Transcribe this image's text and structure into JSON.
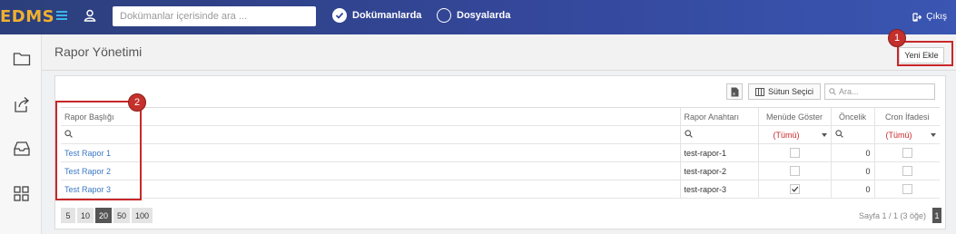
{
  "app": {
    "brand": "EDMS"
  },
  "topbar": {
    "search_placeholder": "Dokümanlar içerisinde ara ...",
    "scope_documents": "Dokümanlarda",
    "scope_files": "Dosyalarda",
    "logout_label": "Çıkış"
  },
  "sidebar": {
    "icons": [
      "folder-icon",
      "share-icon",
      "inbox-icon",
      "apps-grid-icon"
    ]
  },
  "page": {
    "title": "Rapor Yönetimi",
    "new_button": "Yeni Ekle"
  },
  "annotations": {
    "badge_1": "1",
    "badge_2": "2"
  },
  "toolbar": {
    "column_chooser": "Sütun Seçici",
    "search_placeholder": "Ara..."
  },
  "grid": {
    "columns": {
      "title": "Rapor Başlığı",
      "key": "Rapor Anahtarı",
      "show_menu": "Menüde Göster",
      "priority": "Öncelik",
      "cron": "Cron İfadesi"
    },
    "filter_all": "(Tümü)",
    "rows": [
      {
        "title": "Test Rapor 1",
        "key": "test-rapor-1",
        "show_menu": false,
        "priority": "0",
        "cron": false
      },
      {
        "title": "Test Rapor 2",
        "key": "test-rapor-2",
        "show_menu": false,
        "priority": "0",
        "cron": false
      },
      {
        "title": "Test Rapor 3",
        "key": "test-rapor-3",
        "show_menu": true,
        "priority": "0",
        "cron": false
      }
    ]
  },
  "pager": {
    "sizes": [
      "5",
      "10",
      "20",
      "50",
      "100"
    ],
    "active_size": "20",
    "info": "Sayfa 1 / 1 (3 öğe)",
    "current_page": "1"
  },
  "colors": {
    "topbar": "#34479a",
    "brand": "#f0b030",
    "highlight": "#c8272a",
    "link": "#3a78c4"
  }
}
